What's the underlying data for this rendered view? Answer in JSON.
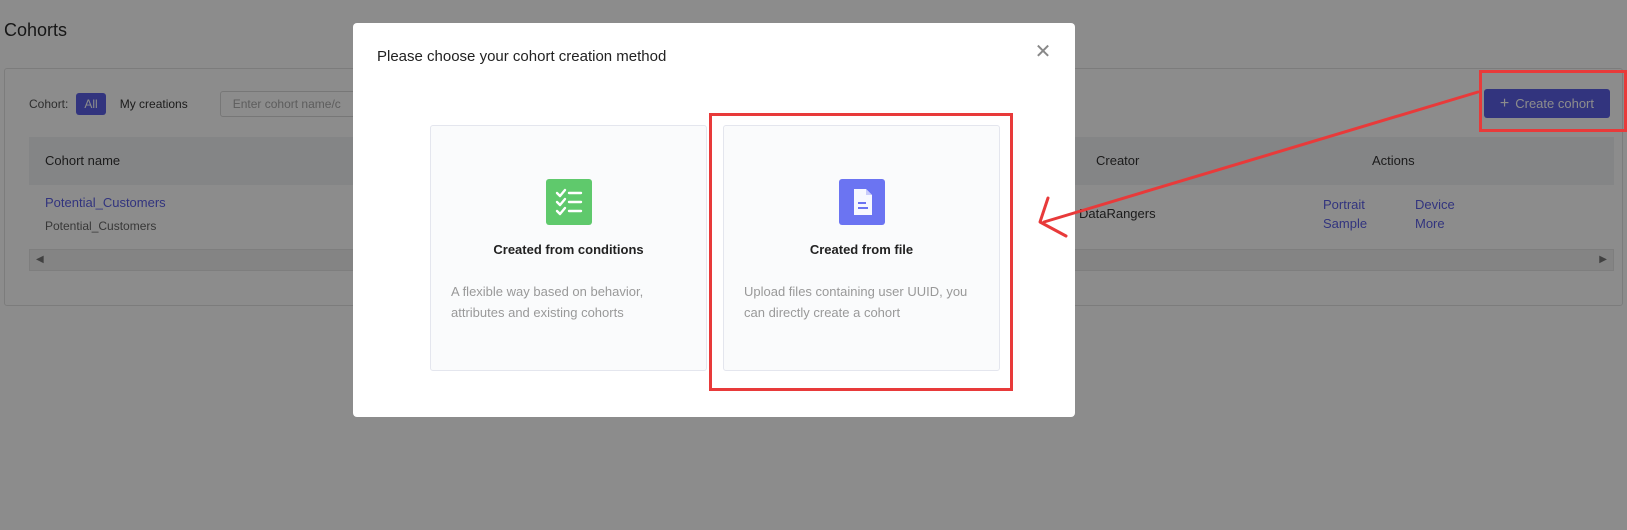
{
  "page": {
    "title": "Cohorts"
  },
  "filter": {
    "label": "Cohort:",
    "tab_all": "All",
    "tab_mine": "My creations",
    "search_placeholder": "Enter cohort name/c"
  },
  "create_button": {
    "label": "Create cohort",
    "icon": "plus-icon"
  },
  "table": {
    "headers": {
      "name": "Cohort name",
      "creator": "Creator",
      "actions": "Actions"
    },
    "rows": [
      {
        "name": "Potential_Customers",
        "subtitle": "Potential_Customers",
        "creator": "DataRangers",
        "actions": [
          "Portrait",
          "Sample",
          "Device",
          "More"
        ]
      }
    ]
  },
  "modal": {
    "title": "Please choose your cohort creation method",
    "close_icon": "close-icon",
    "options": [
      {
        "icon": "checklist-icon",
        "title": "Created from conditions",
        "description": "A flexible way based on behavior, attributes and existing cohorts"
      },
      {
        "icon": "document-icon",
        "title": "Created from file",
        "description": "Upload files containing user UUID, you can directly create a cohort"
      }
    ]
  },
  "colors": {
    "accent": "#5b5fe6",
    "annotation": "#e83a3a",
    "green_icon": "#5fc96c",
    "blue_icon": "#6b74f2"
  }
}
